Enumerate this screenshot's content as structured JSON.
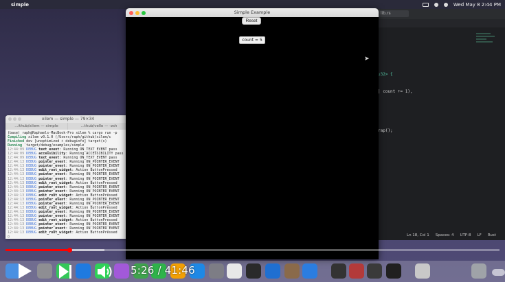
{
  "menubar": {
    "app_name": "simple",
    "datetime": "Wed May 8  2:44 PM"
  },
  "window": {
    "title": "Simple Example",
    "reset_label": "Reset",
    "count_label": "count = 5"
  },
  "terminal": {
    "title": "xilem — simple — 79×34",
    "tabs": [
      "...ithub/xilem — simple",
      "...thub/vello — -zsh"
    ],
    "lines": [
      {
        "type": "plain",
        "text": "(base) raph@Raphaels-MacBook-Pro xilem % cargo run -p"
      },
      {
        "type": "status",
        "label": "Compiling",
        "text": "xilem v0.1.0 (/Users/raph/github/xilem/c"
      },
      {
        "type": "status",
        "label": "Finished",
        "text": "dev [unoptimized + debuginfo] target(s)"
      },
      {
        "type": "status",
        "label": "Running",
        "text": "`target/debug/examples/simple`"
      },
      {
        "type": "log",
        "time": "12:44:09",
        "level": "DEBUG",
        "event": "text_event",
        "text": ": Running ON_TEXT_EVENT pass"
      },
      {
        "type": "log",
        "time": "12:44:09",
        "level": "DEBUG",
        "event": "accessibility",
        "text": ": Running ACCESSIBILITY pass"
      },
      {
        "type": "log",
        "time": "12:44:09",
        "level": "DEBUG",
        "event": "text_event",
        "text": ": Running ON_TEXT_EVENT pass"
      },
      {
        "type": "log",
        "time": "12:44:13",
        "level": "DEBUG",
        "event": "pointer_event",
        "text": ": Running ON_POINTER_EVENT"
      },
      {
        "type": "log",
        "time": "12:44:13",
        "level": "DEBUG",
        "event": "pointer_event",
        "text": ": Running ON_POINTER_EVENT"
      },
      {
        "type": "log",
        "time": "12:44:13",
        "level": "DEBUG",
        "event": "edit_root_widget",
        "text": ": Action ButtonPressed"
      },
      {
        "type": "log",
        "time": "12:44:13",
        "level": "DEBUG",
        "event": "pointer_event",
        "text": ": Running ON_POINTER_EVENT"
      },
      {
        "type": "log",
        "time": "12:44:13",
        "level": "DEBUG",
        "event": "pointer_event",
        "text": ": Running ON_POINTER_EVENT"
      },
      {
        "type": "log",
        "time": "12:44:13",
        "level": "DEBUG",
        "event": "edit_root_widget",
        "text": ": Action ButtonPressed"
      },
      {
        "type": "log",
        "time": "12:44:13",
        "level": "DEBUG",
        "event": "pointer_event",
        "text": ": Running ON_POINTER_EVENT"
      },
      {
        "type": "log",
        "time": "12:44:13",
        "level": "DEBUG",
        "event": "pointer_event",
        "text": ": Running ON_POINTER_EVENT"
      },
      {
        "type": "log",
        "time": "12:44:13",
        "level": "DEBUG",
        "event": "edit_root_widget",
        "text": ": Action ButtonPressed"
      },
      {
        "type": "log",
        "time": "12:44:13",
        "level": "DEBUG",
        "event": "pointer_event",
        "text": ": Running ON_POINTER_EVENT"
      },
      {
        "type": "log",
        "time": "12:44:13",
        "level": "DEBUG",
        "event": "pointer_event",
        "text": ": Running ON_POINTER_EVENT"
      },
      {
        "type": "log",
        "time": "12:44:13",
        "level": "DEBUG",
        "event": "edit_root_widget",
        "text": ": Action ButtonPressed"
      },
      {
        "type": "log",
        "time": "12:44:13",
        "level": "DEBUG",
        "event": "pointer_event",
        "text": ": Running ON_POINTER_EVENT"
      },
      {
        "type": "log",
        "time": "12:44:13",
        "level": "DEBUG",
        "event": "pointer_event",
        "text": ": Running ON_POINTER_EVENT"
      },
      {
        "type": "log",
        "time": "12:44:13",
        "level": "DEBUG",
        "event": "edit_root_widget",
        "text": ": Action ButtonPressed"
      },
      {
        "type": "log",
        "time": "12:44:13",
        "level": "DEBUG",
        "event": "pointer_event",
        "text": ": Running ON_POINTER_EVENT"
      },
      {
        "type": "log",
        "time": "12:44:13",
        "level": "DEBUG",
        "event": "pointer_event",
        "text": ": Running ON_POINTER_EVENT"
      },
      {
        "type": "log",
        "time": "12:44:13",
        "level": "DEBUG",
        "event": "edit_root_widget",
        "text": ": Action ButtonPressed"
      },
      {
        "type": "cursor",
        "text": "▯"
      }
    ]
  },
  "editor": {
    "tab_label": "lib.rs",
    "code": {
      "line1": "u32> {",
      "line2": "| count += 1),",
      "line3": "rap();"
    },
    "status": {
      "position": "Ln 18, Col 1",
      "spaces": "Spaces: 4",
      "encoding": "UTF-8",
      "eol": "LF",
      "language": "Rust"
    }
  },
  "video": {
    "timecode": "5:26 / 41:46",
    "progress_fraction": 0.13,
    "buffer_fraction": 0.2
  },
  "colors": {
    "accent_red": "#ff0000",
    "window_bg": "#000000",
    "debug_blue": "#3a6fd8",
    "status_green": "#2e8b57"
  },
  "dock": {
    "icons": [
      "finder-icon",
      "launchpad-icon",
      "facetime-icon",
      "safari-icon",
      "messages-icon",
      "podcasts-icon",
      "maps-icon",
      "numbers-icon",
      "pages-icon",
      "appstore-icon",
      "settings-icon",
      "chrome-icon",
      "terminal-icon",
      "vscode-icon",
      "instruments-icon",
      "xcode-icon",
      "inkscape-icon",
      "dictionary-icon",
      "screensaver-icon",
      "console-icon",
      "preview-icon",
      "trash-icon"
    ]
  }
}
